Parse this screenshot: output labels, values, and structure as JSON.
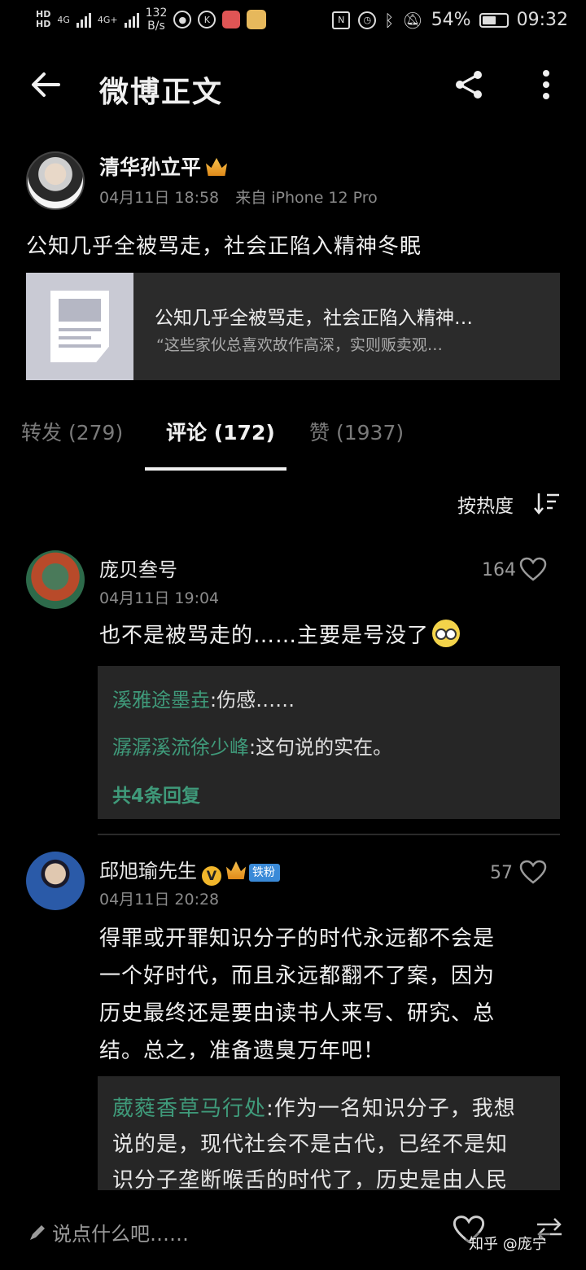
{
  "status_bar": {
    "hd1": "HD",
    "hd2": "HD",
    "net1": "4G",
    "net2": "4G+",
    "speed_value": "132",
    "speed_unit": "B/s",
    "battery": "54%",
    "time": "09:32"
  },
  "header": {
    "title": "微博正文",
    "back_icon": "arrow-left-icon",
    "share_icon": "share-icon",
    "more_icon": "more-vertical-icon"
  },
  "post": {
    "author": "清华孙立平",
    "date": "04月11日 18:58",
    "source": "来自 iPhone 12 Pro",
    "text": "公知几乎全被骂走，社会正陷入精神冬眠",
    "link_card": {
      "title": "公知几乎全被骂走，社会正陷入精神…",
      "subtitle": "“这些家伙总喜欢故作高深，实则贩卖观…"
    }
  },
  "tabs": [
    {
      "label": "转发",
      "count": "(279)"
    },
    {
      "label": "评论",
      "count": "(172)",
      "active": true
    },
    {
      "label": "赞",
      "count": "(1937)"
    }
  ],
  "sort_label": "按热度",
  "comments": [
    {
      "author": "庞贝叁号",
      "date": "04月11日 19:04",
      "likes": "164",
      "text": "也不是被骂走的……主要是号没了",
      "replies": [
        {
          "user": "溪雅途墨垚",
          "text": ":伤感……"
        },
        {
          "user": "潺潺溪流徐少峰",
          "text": ":这句说的实在。"
        }
      ],
      "more_replies": "共4条回复"
    },
    {
      "author": "邱旭瑜先生",
      "badge_verified": "V",
      "badge_fan": "铁粉",
      "date": "04月11日 20:28",
      "likes": "57",
      "text_lines": [
        "得罪或开罪知识分子的时代永远都不会是",
        "一个好时代，而且永远都翻不了案，因为",
        "历史最终还是要由读书人来写、研究、总",
        "结。总之，准备遗臭万年吧！"
      ],
      "reply_user": "葳蕤香草马行处",
      "reply_lines": [
        ":作为一名知识分子，我想",
        "说的是，现代社会不是古代，已经不是知",
        "识分子垄断喉舌的时代了，历史是由人民"
      ]
    }
  ],
  "bottom_bar": {
    "placeholder": "说点什么吧……",
    "watermark": "知乎 @庞宁"
  },
  "colors": {
    "background": "#000000",
    "accent_green": "#3f9a7a",
    "reply_box": "#262626",
    "meta_gray": "#8a8a8a"
  }
}
